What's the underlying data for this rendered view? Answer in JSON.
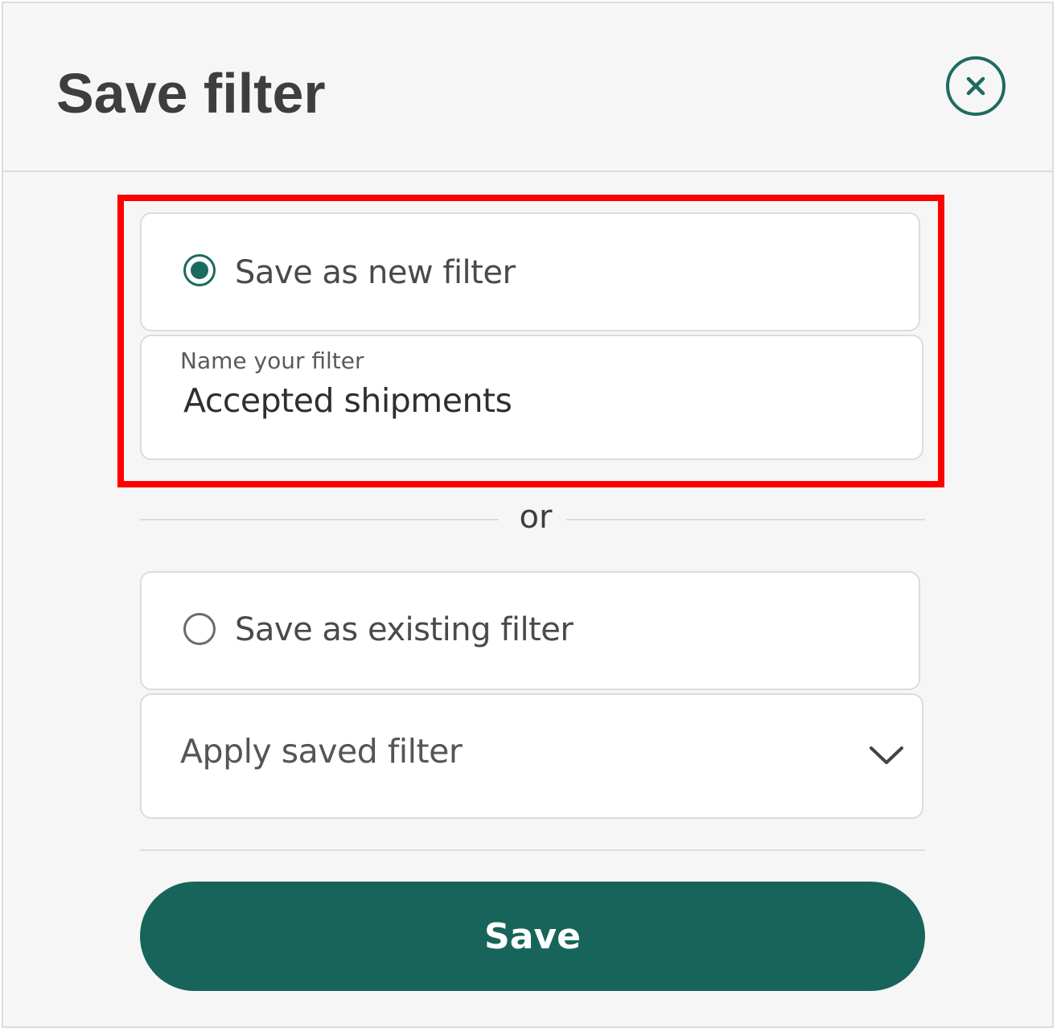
{
  "dialog": {
    "title": "Save filter",
    "close_icon": "close-icon"
  },
  "new_filter_option": {
    "label": "Save as new filter",
    "selected": true
  },
  "name_field": {
    "label": "Name your filter",
    "value": "Accepted shipments"
  },
  "separator": {
    "text": "or"
  },
  "existing_filter_option": {
    "label": "Save as existing filter",
    "selected": false
  },
  "saved_filter_select": {
    "placeholder": "Apply saved filter",
    "icon": "chevron-down-icon"
  },
  "footer": {
    "save_label": "Save"
  },
  "colors": {
    "accent": "#17655a",
    "highlight": "#ff0000",
    "panel_bg": "#f6f6f6",
    "title_text": "#3e3e3e"
  }
}
